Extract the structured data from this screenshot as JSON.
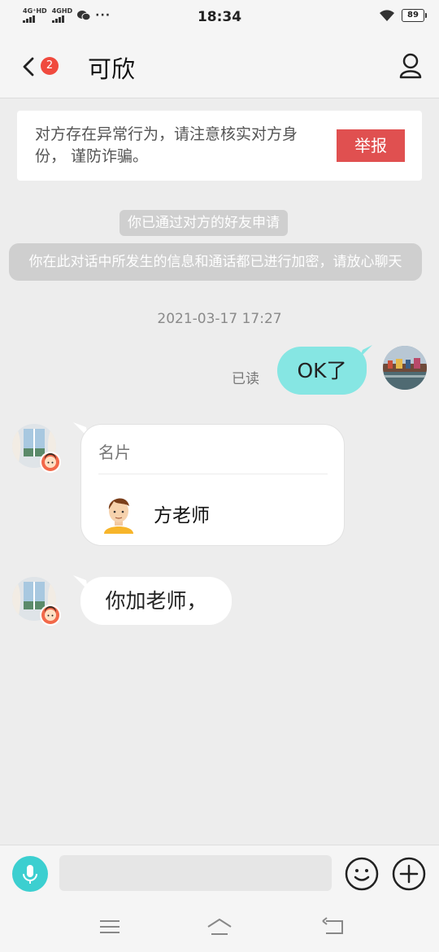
{
  "status_bar": {
    "signal1": "4G⁺HD",
    "signal2": "4GHD",
    "more": "···",
    "time": "18:34",
    "battery": "89"
  },
  "header": {
    "unread_count": "2",
    "title": "可欣"
  },
  "warning": {
    "text": "对方存在异常行为，请注意核实对方身份， 谨防诈骗。",
    "report_label": "举报"
  },
  "system_messages": {
    "friend_accepted": "你已通过对方的好友申请",
    "encryption": "你在此对话中所发生的信息和通话都已进行加密，请放心聊天"
  },
  "timestamp": "2021-03-17 17:27",
  "messages": {
    "sent_read_status": "已读",
    "sent_text": "OK了",
    "card_title": "名片",
    "card_name": "方老师",
    "received_text": "你加老师，"
  },
  "input": {
    "placeholder": ""
  },
  "colors": {
    "accent": "#3ccfd0",
    "sent_bubble": "#86e6e3",
    "report": "#e05050",
    "badge": "#f04a3e"
  }
}
